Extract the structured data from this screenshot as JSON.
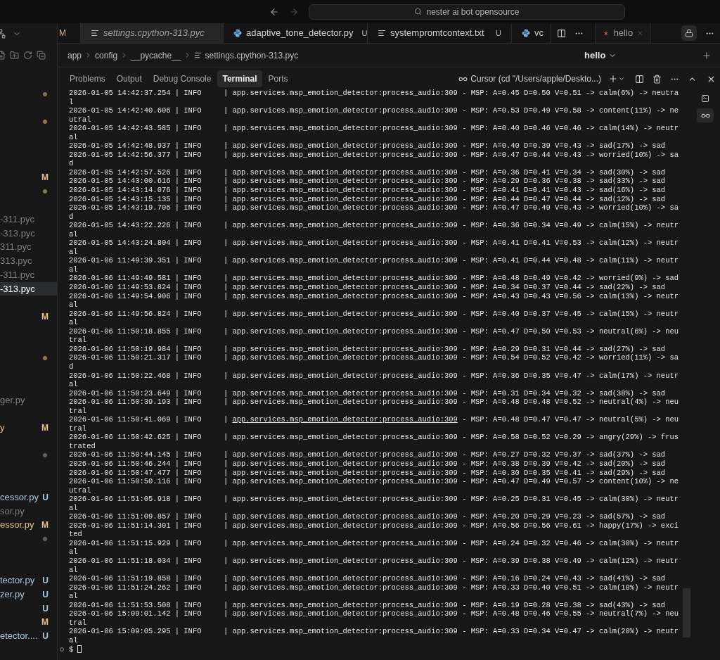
{
  "title_bar": {
    "search": "nester ai bot opensource"
  },
  "explorer": {
    "rows": [
      {
        "kind": "folder",
        "color": "#8a7550",
        "selected": false
      },
      {
        "kind": "empty"
      },
      {
        "kind": "folder",
        "color": "#8a7550",
        "selected": false
      },
      {
        "kind": "empty"
      },
      {
        "kind": "empty"
      },
      {
        "kind": "empty"
      },
      {
        "kind": "file",
        "color": "#e2c08d",
        "badge": "M",
        "selected": false
      },
      {
        "kind": "folder",
        "color": "#8a7550",
        "selected": false
      },
      {
        "kind": "empty"
      },
      {
        "kind": "file",
        "color": "#7f7f7f",
        "name": "-311.pyc",
        "selected": false
      },
      {
        "kind": "file",
        "color": "#7f7f7f",
        "name": "-313.pyc",
        "selected": false
      },
      {
        "kind": "file",
        "color": "#7f7f7f",
        "name": "311.pyc",
        "selected": false
      },
      {
        "kind": "file",
        "color": "#7f7f7f",
        "name": "313.pyc",
        "selected": false
      },
      {
        "kind": "file",
        "color": "#7f7f7f",
        "name": "-311.pyc",
        "selected": false
      },
      {
        "kind": "file",
        "name": "-313.pyc",
        "selected": true
      },
      {
        "kind": "empty"
      },
      {
        "kind": "file",
        "color": "#e2c08d",
        "badge": "M",
        "selected": false
      },
      {
        "kind": "empty"
      },
      {
        "kind": "empty"
      },
      {
        "kind": "folder",
        "color": "#8a7550",
        "selected": false
      },
      {
        "kind": "empty"
      },
      {
        "kind": "empty"
      },
      {
        "kind": "file",
        "color": "#7f7f7f",
        "name": "ger.py",
        "selected": false
      },
      {
        "kind": "empty"
      },
      {
        "kind": "file",
        "color": "#e2c08d",
        "name": "y",
        "badge": "M",
        "selected": false
      },
      {
        "kind": "empty"
      },
      {
        "kind": "folder",
        "color": "#5f6368",
        "selected": false
      },
      {
        "kind": "empty"
      },
      {
        "kind": "empty"
      },
      {
        "kind": "file",
        "color": "#a9c9de",
        "name": "cessor.py",
        "badge": "U",
        "selected": false
      },
      {
        "kind": "file",
        "color": "#7f7f7f",
        "name": "sor.py",
        "selected": false
      },
      {
        "kind": "file",
        "color": "#e2c08d",
        "name": "essor.py",
        "badge": "M",
        "selected": false
      },
      {
        "kind": "folder",
        "color": "#5f6368",
        "selected": false
      },
      {
        "kind": "empty"
      },
      {
        "kind": "empty"
      },
      {
        "kind": "file",
        "color": "#a9c9de",
        "name": "tector.py",
        "badge": "U",
        "selected": false
      },
      {
        "kind": "file",
        "color": "#a9c9de",
        "name": "zer.py",
        "badge": "U",
        "selected": false
      },
      {
        "kind": "file",
        "color": "#a9c9de",
        "badge": "U",
        "selected": false
      },
      {
        "kind": "file",
        "color": "#e2c08d",
        "badge": "M",
        "selected": false
      },
      {
        "kind": "file",
        "color": "#a9c9de",
        "name": "etector....",
        "badge": "U",
        "selected": false
      }
    ]
  },
  "editor_tabs": [
    {
      "kind": "fragment",
      "badge": "M",
      "selected": false
    },
    {
      "kind": "text",
      "label": "settings.cpython-313.pyc",
      "italic": true,
      "selected": true
    },
    {
      "kind": "python",
      "label": "adaptive_tone_detector.py",
      "italic": false,
      "badge": "U",
      "selected": false
    },
    {
      "kind": "text",
      "label": "systempromtcontext.txt",
      "italic": false,
      "badge": "U",
      "selected": false
    },
    {
      "kind": "python",
      "label": "vc",
      "italic": false,
      "selected": false
    }
  ],
  "chat_panel": {
    "tab": "hello",
    "title": "hello"
  },
  "breadcrumb": [
    "app",
    "config",
    "__pycache__",
    "settings.cpython-313.pyc"
  ],
  "panel_tabs": [
    {
      "label": "Problems",
      "selected": false
    },
    {
      "label": "Output",
      "selected": false
    },
    {
      "label": "Debug Console",
      "selected": false
    },
    {
      "label": "Terminal",
      "selected": true
    },
    {
      "label": "Ports",
      "selected": false
    }
  ],
  "terminal": {
    "title": "Cursor (cd \"/Users/apple/Deskto...)",
    "lines": [
      {
        "prefix": "2026-01-05 14:42:37.254 | INFO     | ",
        "source": "app.services.msp_emotion_detector:process_audio:309",
        "message": " - MSP: A=0.45 D=0.50 V=0.51 -> calm(6%) -> neutral",
        "hovered": false
      },
      {
        "prefix": "2026-01-05 14:42:40.606 | INFO     | ",
        "source": "app.services.msp_emotion_detector:process_audio:309",
        "message": " - MSP: A=0.53 D=0.49 V=0.58 -> content(11%) -> neutral",
        "hovered": false
      },
      {
        "prefix": "2026-01-05 14:42:43.585 | INFO     | ",
        "source": "app.services.msp_emotion_detector:process_audio:309",
        "message": " - MSP: A=0.40 D=0.46 V=0.46 -> calm(14%) -> neutral",
        "hovered": false
      },
      {
        "prefix": "2026-01-05 14:42:48.937 | INFO     | ",
        "source": "app.services.msp_emotion_detector:process_audio:309",
        "message": " - MSP: A=0.40 D=0.39 V=0.43 -> sad(17%) -> sad",
        "hovered": false
      },
      {
        "prefix": "2026-01-05 14:42:56.377 | INFO     | ",
        "source": "app.services.msp_emotion_detector:process_audio:309",
        "message": " - MSP: A=0.47 D=0.44 V=0.43 -> worried(10%) -> sad",
        "hovered": false
      },
      {
        "prefix": "2026-01-05 14:42:57.526 | INFO     | ",
        "source": "app.services.msp_emotion_detector:process_audio:309",
        "message": " - MSP: A=0.36 D=0.41 V=0.34 -> sad(30%) -> sad",
        "hovered": false
      },
      {
        "prefix": "2026-01-05 14:43:00.616 | INFO     | ",
        "source": "app.services.msp_emotion_detector:process_audio:309",
        "message": " - MSP: A=0.29 D=0.36 V=0.38 -> sad(33%) -> sad",
        "hovered": false
      },
      {
        "prefix": "2026-01-05 14:43:14.076 | INFO     | ",
        "source": "app.services.msp_emotion_detector:process_audio:309",
        "message": " - MSP: A=0.41 D=0.41 V=0.43 -> sad(16%) -> sad",
        "hovered": false
      },
      {
        "prefix": "2026-01-05 14:43:15.135 | INFO     | ",
        "source": "app.services.msp_emotion_detector:process_audio:309",
        "message": " - MSP: A=0.44 D=0.47 V=0.44 -> sad(12%) -> sad",
        "hovered": false
      },
      {
        "prefix": "2026-01-05 14:43:19.706 | INFO     | ",
        "source": "app.services.msp_emotion_detector:process_audio:309",
        "message": " - MSP: A=0.47 D=0.49 V=0.43 -> worried(10%) -> sad",
        "hovered": false
      },
      {
        "prefix": "2026-01-05 14:43:22.226 | INFO     | ",
        "source": "app.services.msp_emotion_detector:process_audio:309",
        "message": " - MSP: A=0.36 D=0.34 V=0.49 -> calm(15%) -> neutral",
        "hovered": false
      },
      {
        "prefix": "2026-01-05 14:43:24.804 | INFO     | ",
        "source": "app.services.msp_emotion_detector:process_audio:309",
        "message": " - MSP: A=0.41 D=0.41 V=0.53 -> calm(12%) -> neutral",
        "hovered": false
      },
      {
        "prefix": "2026-01-06 11:49:39.351 | INFO     | ",
        "source": "app.services.msp_emotion_detector:process_audio:309",
        "message": " - MSP: A=0.41 D=0.44 V=0.48 -> calm(11%) -> neutral",
        "hovered": false
      },
      {
        "prefix": "2026-01-06 11:49:49.581 | INFO     | ",
        "source": "app.services.msp_emotion_detector:process_audio:309",
        "message": " - MSP: A=0.48 D=0.49 V=0.42 -> worried(9%) -> sad",
        "hovered": false
      },
      {
        "prefix": "2026-01-06 11:49:53.824 | INFO     | ",
        "source": "app.services.msp_emotion_detector:process_audio:309",
        "message": " - MSP: A=0.34 D=0.37 V=0.44 -> sad(22%) -> sad",
        "hovered": false
      },
      {
        "prefix": "2026-01-06 11:49:54.906 | INFO     | ",
        "source": "app.services.msp_emotion_detector:process_audio:309",
        "message": " - MSP: A=0.43 D=0.43 V=0.56 -> calm(13%) -> neutral",
        "hovered": false
      },
      {
        "prefix": "2026-01-06 11:49:56.824 | INFO     | ",
        "source": "app.services.msp_emotion_detector:process_audio:309",
        "message": " - MSP: A=0.40 D=0.37 V=0.45 -> calm(15%) -> neutral",
        "hovered": false
      },
      {
        "prefix": "2026-01-06 11:50:18.855 | INFO     | ",
        "source": "app.services.msp_emotion_detector:process_audio:309",
        "message": " - MSP: A=0.47 D=0.50 V=0.53 -> neutral(6%) -> neutral",
        "hovered": false
      },
      {
        "prefix": "2026-01-06 11:50:19.984 | INFO     | ",
        "source": "app.services.msp_emotion_detector:process_audio:309",
        "message": " - MSP: A=0.29 D=0.31 V=0.44 -> sad(27%) -> sad",
        "hovered": false
      },
      {
        "prefix": "2026-01-06 11:50:21.317 | INFO     | ",
        "source": "app.services.msp_emotion_detector:process_audio:309",
        "message": " - MSP: A=0.54 D=0.52 V=0.42 -> worried(11%) -> sad",
        "hovered": false
      },
      {
        "prefix": "2026-01-06 11:50:22.468 | INFO     | ",
        "source": "app.services.msp_emotion_detector:process_audio:309",
        "message": " - MSP: A=0.36 D=0.35 V=0.47 -> calm(17%) -> neutral",
        "hovered": false
      },
      {
        "prefix": "2026-01-06 11:50:23.649 | INFO     | ",
        "source": "app.services.msp_emotion_detector:process_audio:309",
        "message": " - MSP: A=0.31 D=0.34 V=0.32 -> sad(38%) -> sad",
        "hovered": false
      },
      {
        "prefix": "2026-01-06 11:50:39.193 | INFO     | ",
        "source": "app.services.msp_emotion_detector:process_audio:309",
        "message": " - MSP: A=0.48 D=0.48 V=0.52 -> neutral(4%) -> neutral",
        "hovered": false
      },
      {
        "prefix": "2026-01-06 11:50:41.069 | INFO     | ",
        "source": "app.services.msp_emotion_detector:process_audio:309",
        "message": " - MSP: A=0.48 D=0.47 V=0.47 -> neutral(5%) -> neutral",
        "hovered": true
      },
      {
        "prefix": "2026-01-06 11:50:42.625 | INFO     | ",
        "source": "app.services.msp_emotion_detector:process_audio:309",
        "message": " - MSP: A=0.58 D=0.52 V=0.29 -> angry(29%) -> frustrated",
        "hovered": false
      },
      {
        "prefix": "2026-01-06 11:50:44.145 | INFO     | ",
        "source": "app.services.msp_emotion_detector:process_audio:309",
        "message": " - MSP: A=0.27 D=0.32 V=0.37 -> sad(37%) -> sad",
        "hovered": false
      },
      {
        "prefix": "2026-01-06 11:50:46.244 | INFO     | ",
        "source": "app.services.msp_emotion_detector:process_audio:309",
        "message": " - MSP: A=0.38 D=0.39 V=0.42 -> sad(20%) -> sad",
        "hovered": false
      },
      {
        "prefix": "2026-01-06 11:50:47.477 | INFO     | ",
        "source": "app.services.msp_emotion_detector:process_audio:309",
        "message": " - MSP: A=0.30 D=0.35 V=0.41 -> sad(29%) -> sad",
        "hovered": false
      },
      {
        "prefix": "2026-01-06 11:50:50.116 | INFO     | ",
        "source": "app.services.msp_emotion_detector:process_audio:309",
        "message": " - MSP: A=0.47 D=0.49 V=0.57 -> content(10%) -> neutral",
        "hovered": false
      },
      {
        "prefix": "2026-01-06 11:51:05.918 | INFO     | ",
        "source": "app.services.msp_emotion_detector:process_audio:309",
        "message": " - MSP: A=0.25 D=0.31 V=0.45 -> calm(30%) -> neutral",
        "hovered": false
      },
      {
        "prefix": "2026-01-06 11:51:09.857 | INFO     | ",
        "source": "app.services.msp_emotion_detector:process_audio:309",
        "message": " - MSP: A=0.20 D=0.29 V=0.23 -> sad(57%) -> sad",
        "hovered": false
      },
      {
        "prefix": "2026-01-06 11:51:14.301 | INFO     | ",
        "source": "app.services.msp_emotion_detector:process_audio:309",
        "message": " - MSP: A=0.56 D=0.56 V=0.61 -> happy(17%) -> excited",
        "hovered": false
      },
      {
        "prefix": "2026-01-06 11:51:15.929 | INFO     | ",
        "source": "app.services.msp_emotion_detector:process_audio:309",
        "message": " - MSP: A=0.24 D=0.32 V=0.46 -> calm(30%) -> neutral",
        "hovered": false
      },
      {
        "prefix": "2026-01-06 11:51:18.034 | INFO     | ",
        "source": "app.services.msp_emotion_detector:process_audio:309",
        "message": " - MSP: A=0.39 D=0.38 V=0.49 -> calm(12%) -> neutral",
        "hovered": false
      },
      {
        "prefix": "2026-01-06 11:51:19.858 | INFO     | ",
        "source": "app.services.msp_emotion_detector:process_audio:309",
        "message": " - MSP: A=0.16 D=0.24 V=0.43 -> sad(41%) -> sad",
        "hovered": false
      },
      {
        "prefix": "2026-01-06 11:51:24.262 | INFO     | ",
        "source": "app.services.msp_emotion_detector:process_audio:309",
        "message": " - MSP: A=0.33 D=0.40 V=0.51 -> calm(18%) -> neutral",
        "hovered": false
      },
      {
        "prefix": "2026-01-06 11:51:53.508 | INFO     | ",
        "source": "app.services.msp_emotion_detector:process_audio:309",
        "message": " - MSP: A=0.19 D=0.28 V=0.38 -> sad(43%) -> sad",
        "hovered": false
      },
      {
        "prefix": "2026-01-06 15:09:01.142 | INFO     | ",
        "source": "app.services.msp_emotion_detector:process_audio:309",
        "message": " - MSP: A=0.48 D=0.46 V=0.55 -> neutral(7%) -> neutral",
        "hovered": false
      },
      {
        "prefix": "2026-01-06 15:09:05.295 | INFO     | ",
        "source": "app.services.msp_emotion_detector:process_audio:309",
        "message": " - MSP: A=0.33 D=0.34 V=0.47 -> calm(20%) -> neutral",
        "hovered": false
      }
    ],
    "prompt": "$"
  },
  "side_icons": [
    {
      "kind": "terminal",
      "selected": false
    },
    {
      "kind": "agent",
      "selected": true
    }
  ]
}
